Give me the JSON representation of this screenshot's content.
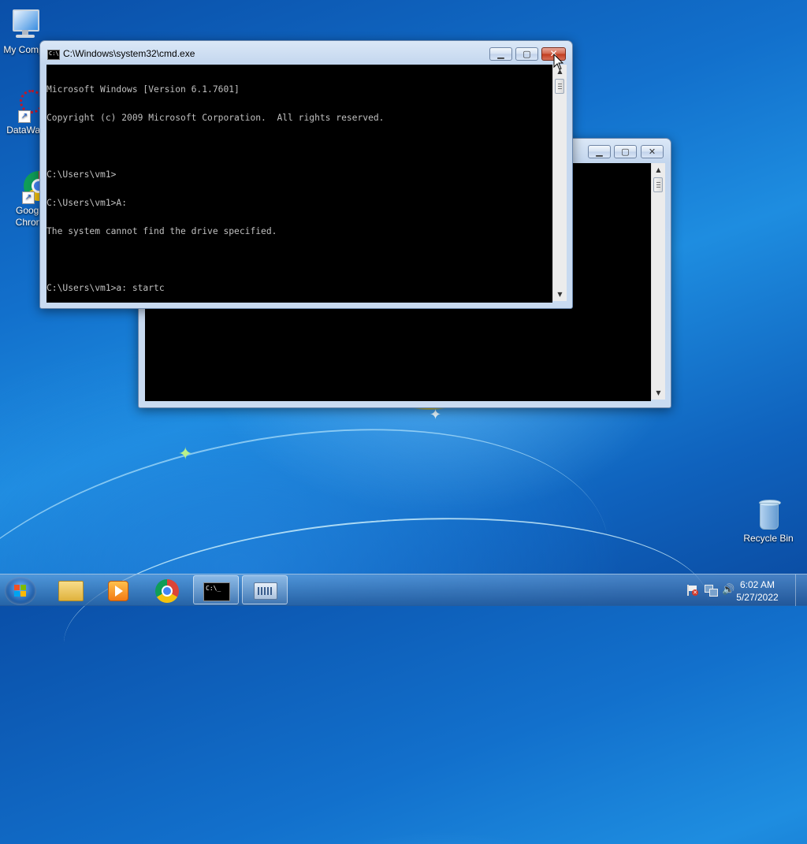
{
  "desktop": {
    "icons": [
      {
        "label": "My Comp",
        "label2": ""
      },
      {
        "label": "DataWag",
        "label2": ""
      },
      {
        "label": "Googl",
        "label2": "Chron"
      },
      {
        "label": "Recycle Bin",
        "label2": ""
      }
    ]
  },
  "front_window": {
    "title": "C:\\Windows\\system32\\cmd.exe",
    "icon_text": "C:\\",
    "lines": [
      "Microsoft Windows [Version 6.1.7601]",
      "Copyright (c) 2009 Microsoft Corporation.  All rights reserved.",
      "",
      "C:\\Users\\vm1>",
      "C:\\Users\\vm1>A:",
      "The system cannot find the drive specified.",
      "",
      "C:\\Users\\vm1>a: startc"
    ]
  },
  "back_window": {
    "title": ""
  },
  "controls": {
    "minimize": "▁",
    "maximize": "▢",
    "close": "✕"
  },
  "taskbar": {
    "cmd_text": "C:\\_",
    "time": "6:02 AM",
    "date": "5/27/2022"
  }
}
